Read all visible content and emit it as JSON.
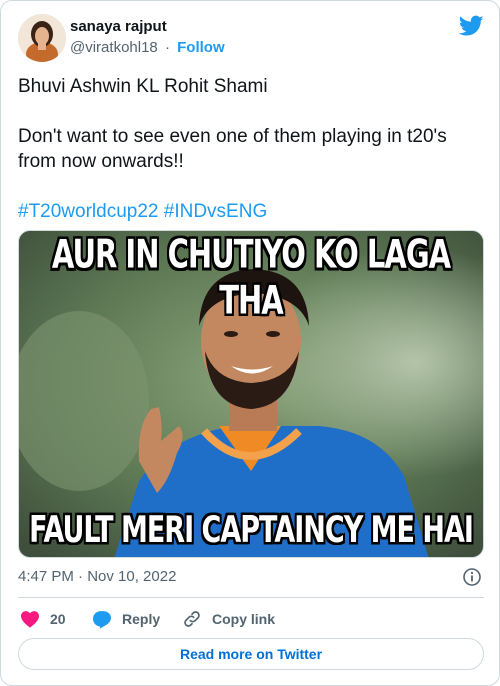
{
  "tweet": {
    "author": {
      "name": "sanaya rajput",
      "handle": "@viratkohl18",
      "separator": "·",
      "follow_label": "Follow"
    },
    "text_lines": [
      "Bhuvi Ashwin KL Rohit Shami",
      "Don't want to see even one of them playing in t20's from now onwards!!"
    ],
    "hashtags": [
      "#T20worldcup22",
      "#INDvsENG"
    ],
    "media": {
      "top_caption": "AUR IN CHUTIYO KO LAGA THA",
      "bottom_caption": "FAULT MERI CAPTAINCY ME HAI"
    },
    "timestamp": "4:47 PM · Nov 10, 2022",
    "actions": {
      "like_count": "20",
      "reply_label": "Reply",
      "copy_label": "Copy link"
    },
    "read_more_label": "Read more on Twitter"
  },
  "icons": {
    "brand": "twitter-bird-icon",
    "like": "heart-icon",
    "reply": "speech-bubble-icon",
    "copy": "link-icon",
    "info": "info-icon"
  },
  "colors": {
    "accent": "#1d9bf0",
    "link_button": "#006fd6",
    "like": "#f91880",
    "muted": "#536471",
    "text": "#0f1419",
    "border": "#cfd9de"
  }
}
